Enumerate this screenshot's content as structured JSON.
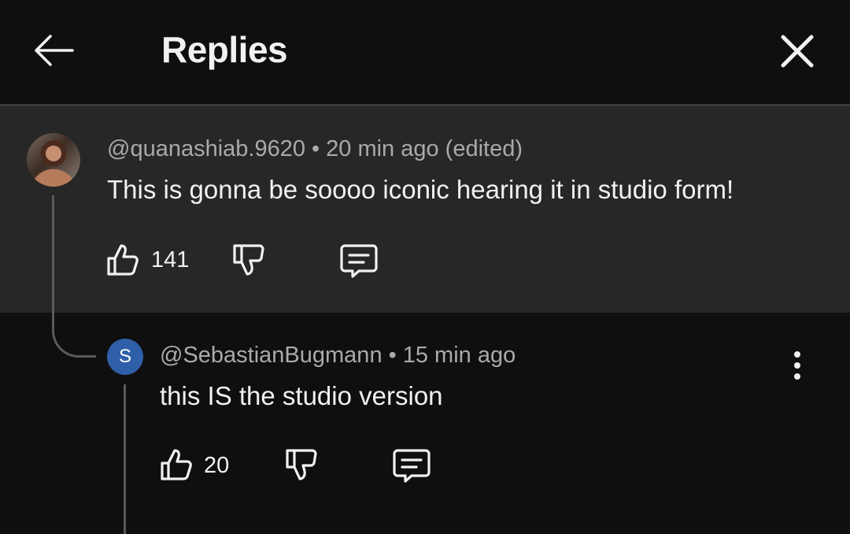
{
  "header": {
    "title": "Replies",
    "back_icon": "arrow-left-icon",
    "close_icon": "close-icon"
  },
  "comments": [
    {
      "handle": "@quanashiab.9620",
      "time": "20 min ago (edited)",
      "text": "This is gonna be soooo iconic hearing it in studio form!",
      "likes": "141",
      "avatar": "profile-photo"
    },
    {
      "handle": "@SebastianBugmann",
      "time": "15 min ago",
      "text": "this IS the studio version",
      "likes": "20",
      "avatar_letter": "S",
      "avatar_color": "#2f5fa8"
    }
  ],
  "separator": "•",
  "colors": {
    "background": "#0f0f0f",
    "highlighted_comment": "#272727",
    "meta_text": "#aaaaaa",
    "primary_text": "#f1f1f1"
  }
}
